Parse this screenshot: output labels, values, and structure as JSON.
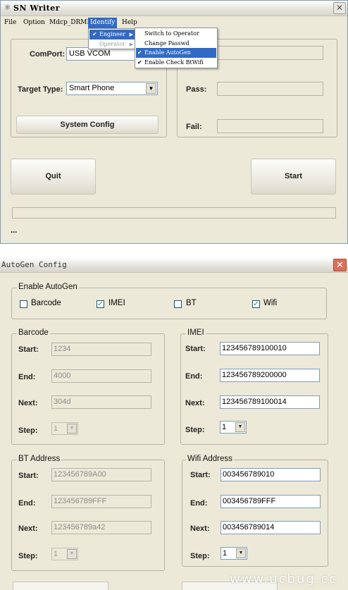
{
  "writer": {
    "title": "SN Writer",
    "menu": [
      "File",
      "Option",
      "Mdcp_DRMKey",
      "Identify",
      "Help"
    ],
    "identify_menu": {
      "engineer": "Engineer",
      "operator": "Operator"
    },
    "engineer_submenu": [
      "Switch to Operator",
      "Change Passwd",
      "Enable AutoGen",
      "Enable Check BtWifi"
    ],
    "comport_label": "ComPort:",
    "comport_value": "USB VCOM",
    "target_label": "Target Type:",
    "target_value": "Smart Phone",
    "system_config": "System Config",
    "pass_label": "Pass:",
    "fail_label": "Fail:",
    "quit": "Quit",
    "start": "Start",
    "status": "...",
    "progress": 0
  },
  "autogen": {
    "title": "AutoGen Config",
    "enable_title": "Enable AutoGen",
    "checks": [
      {
        "label": "Barcode",
        "checked": false
      },
      {
        "label": "IMEI",
        "checked": true
      },
      {
        "label": "BT",
        "checked": false
      },
      {
        "label": "Wifi",
        "checked": true
      }
    ],
    "labels": {
      "start": "Start:",
      "end": "End:",
      "next": "Next:",
      "step": "Step:"
    },
    "barcode": {
      "title": "Barcode",
      "start": "1234",
      "end": "4000",
      "next": "304d",
      "step": "1"
    },
    "imei": {
      "title": "IMEI",
      "start": "123456789100010",
      "end": "123456789200000",
      "next": "123456789100014",
      "step": "1"
    },
    "bt": {
      "title": "BT Address",
      "start": "123456789A00",
      "end": "123456789FFF",
      "next": "123456789a42",
      "step": "1"
    },
    "wifi": {
      "title": "Wifi Address",
      "start": "003456789010",
      "end": "003456789FFF",
      "next": "003456789014",
      "step": "1"
    }
  },
  "watermark": "www.ucbug.cc"
}
